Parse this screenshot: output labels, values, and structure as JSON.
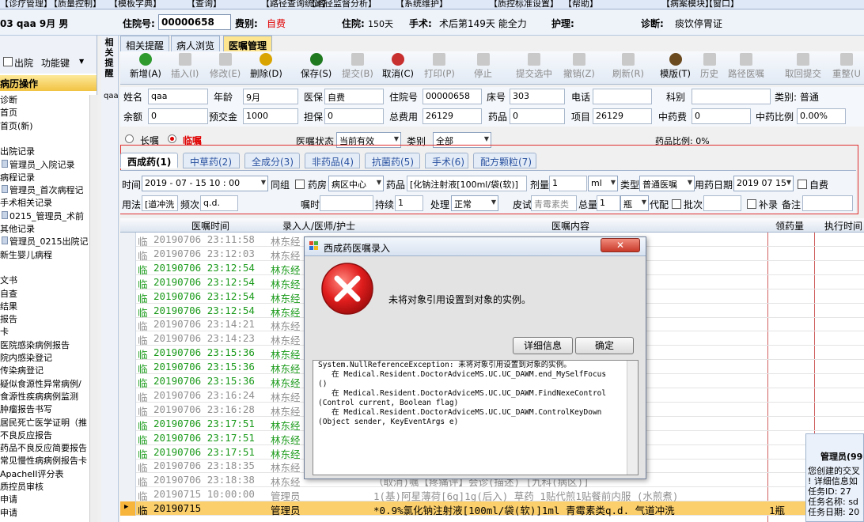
{
  "menu": [
    "【诊疗管理】",
    "【质量控制】",
    "【模板字典】",
    "【查询】",
    "【路径查询统计】",
    "【路径监督分析】",
    "【系统维护】",
    "【质控标准设置】",
    "【帮助】",
    "【病案模块】",
    "【窗口】"
  ],
  "patient": {
    "left": "03  qaa 9月 男",
    "inpatient_label": "住院号:",
    "inpatient_no": "00000658",
    "fee_label": "费别:",
    "fee": "自费",
    "stay_label": "住院:",
    "stay": "150天",
    "surgery_label": "手术:",
    "surgery": "术后第149天 能全力",
    "nursing_label": "护理:",
    "diag_label": "诊断:",
    "diag": "痰饮停胃证"
  },
  "left_panel": {
    "discharge": "出院",
    "func_key": "功能键",
    "section": "病历操作",
    "items": [
      "诊断",
      "首页",
      "首页(新)",
      "",
      "出院记录",
      "管理员_入院记录",
      "病程记录",
      "管理员_首次病程记",
      "手术相关记录",
      "0215_管理员_术前",
      "其他记录",
      "管理员_0215出院记",
      "新生婴儿病程",
      "",
      "文书",
      "自查",
      "结果",
      "报告",
      "卡",
      "医院感染病例报告",
      "院内感染登记",
      "传染病登记",
      "疑似食源性异常病例/",
      "食源性疾病病例监测",
      "肿瘤报告书写",
      "居民死亡医学证明（推",
      "不良反应报告",
      "药品不良反应简要报告",
      "常见慢性病病例报告卡",
      "ApacheII评分表",
      "质控员审核",
      "申请",
      "申请"
    ]
  },
  "vtabs": [
    "相关提醒",
    "qaa"
  ],
  "tabs": [
    "相关提醒",
    "病人浏览",
    "医嘱管理"
  ],
  "toolbar": [
    {
      "label": "新增(A)",
      "icon": "add-icon",
      "enabled": true,
      "color": "#2e9a2e"
    },
    {
      "label": "插入(I)",
      "icon": "insert-icon",
      "enabled": false
    },
    {
      "label": "修改(E)",
      "icon": "edit-icon",
      "enabled": false
    },
    {
      "label": "删除(D)",
      "icon": "delete-icon",
      "enabled": true,
      "color": "#d9a400"
    },
    {
      "label": "保存(S)",
      "icon": "save-icon",
      "enabled": true,
      "color": "#1f7a1f"
    },
    {
      "label": "提交(B)",
      "icon": "submit-icon",
      "enabled": false
    },
    {
      "label": "取消(C)",
      "icon": "undo-icon",
      "enabled": true,
      "color": "#c83030"
    },
    {
      "label": "打印(P)",
      "icon": "print-icon",
      "enabled": false
    },
    {
      "label": "停止",
      "icon": "stop-icon",
      "enabled": false
    },
    {
      "label": "提交选中",
      "icon": "submit-selected-icon",
      "enabled": false
    },
    {
      "label": "撤销(Z)",
      "icon": "trash-icon",
      "enabled": false
    },
    {
      "label": "刷新(R)",
      "icon": "refresh-icon",
      "enabled": false
    },
    {
      "label": "模版(T)",
      "icon": "template-icon",
      "enabled": true,
      "color": "#6b4a1f"
    },
    {
      "label": "历史",
      "icon": "history-icon",
      "enabled": false
    },
    {
      "label": "路径医嘱",
      "icon": "path-order-icon",
      "enabled": false
    },
    {
      "label": "取回提交",
      "icon": "retrieve-icon",
      "enabled": false
    },
    {
      "label": "重整(U",
      "icon": "reorganize-icon",
      "enabled": false
    }
  ],
  "info": {
    "name_label": "姓名",
    "name": "qaa",
    "age_label": "年龄",
    "age": "9月",
    "insurance_label": "医保",
    "insurance": "自费",
    "inpatient_label": "住院号",
    "inpatient": "00000658",
    "bed_label": "床号",
    "bed": "303",
    "phone_label": "电话",
    "phone": "",
    "dept_label": "科别",
    "dept": "",
    "category": "类别: 普通",
    "balance_label": "余额",
    "balance": "0",
    "deposit_label": "预交金",
    "deposit": "1000",
    "guarantee_label": "担保",
    "guarantee": "0",
    "total_label": "总费用",
    "total": "26129",
    "drug_label": "药品",
    "drug": "0",
    "item_label": "项目",
    "item": "26129",
    "tcm_label": "中药费",
    "tcm": "0",
    "tcm_ratio_label": "中药比例",
    "tcm_ratio": "0.00%"
  },
  "order_row": {
    "long": "长嘱",
    "temp": "临嘱",
    "status_label": "医嘱状态",
    "status": "当前有效",
    "type_label": "类别",
    "type": "全部",
    "drug_ratio": "药品比例: 0%"
  },
  "order_tabs": [
    "西成药(1)",
    "中草药(2)",
    "全成分(3)",
    "非药品(4)",
    "抗菌药(5)",
    "手术(6)",
    "配方颗粒(7)"
  ],
  "entry": {
    "time_label": "时间",
    "time": "2019 - 07 - 15 10 : 00",
    "group_label": "同组",
    "pharmacy_label": "药房",
    "pharmacy": "病区中心",
    "drug_label": "药品",
    "drug": "[化钠注射液[100ml/袋(软)]",
    "dose_label": "剂量",
    "dose": "1",
    "unit": "ml",
    "kind_label": "类型",
    "kind": "普通医嘱",
    "date_label": "用药日期",
    "date": "2019 07 15",
    "selfpay_label": "自费",
    "usage_label": "用法",
    "usage": "[道冲洗",
    "freq_label": "频次",
    "freq": "q.d.",
    "instruct_label": "嘱时",
    "duration_label": "持续",
    "duration": "1",
    "handle_label": "处理",
    "handle": "正常",
    "skin_label": "皮试",
    "skin": "青霉素类",
    "total_label": "总量",
    "total": "1",
    "total_unit": "瓶",
    "dai_label": "代配",
    "batch_label": "批次",
    "supp_label": "补录",
    "remark_label": "备注"
  },
  "table": {
    "headers": [
      "医嘱时间",
      "录入人/医师/护士",
      "医嘱内容",
      "领药量",
      "执行时间"
    ],
    "rows": [
      {
        "type": "临",
        "time": "20190706 23:11:58",
        "person": "林东经",
        "content": "",
        "qty": "",
        "color": "#909090"
      },
      {
        "type": "临",
        "time": "20190706 23:12:03",
        "person": "林东经",
        "content": "",
        "qty": "",
        "color": "#909090"
      },
      {
        "type": "临",
        "time": "20190706 23:12:54",
        "person": "林东经",
        "content": "",
        "qty": "",
        "color": "#1a9a1a"
      },
      {
        "type": "临",
        "time": "20190706 23:12:54",
        "person": "林东经",
        "content": "",
        "qty": "",
        "color": "#1a9a1a"
      },
      {
        "type": "临",
        "time": "20190706 23:12:54",
        "person": "林东经",
        "content": "",
        "qty": "",
        "color": "#1a9a1a"
      },
      {
        "type": "临",
        "time": "20190706 23:12:54",
        "person": "林东经",
        "content": "",
        "qty": "",
        "color": "#1a9a1a"
      },
      {
        "type": "临",
        "time": "20190706 23:14:21",
        "person": "林东经",
        "content": "",
        "qty": "",
        "color": "#909090"
      },
      {
        "type": "临",
        "time": "20190706 23:14:23",
        "person": "林东经",
        "content": "",
        "qty": "",
        "color": "#909090"
      },
      {
        "type": "临",
        "time": "20190706 23:15:36",
        "person": "林东经",
        "content": "",
        "qty": "",
        "color": "#1a9a1a"
      },
      {
        "type": "临",
        "time": "20190706 23:15:36",
        "person": "林东经",
        "content": "",
        "qty": "",
        "color": "#1a9a1a"
      },
      {
        "type": "临",
        "time": "20190706 23:15:36",
        "person": "林东经",
        "content": "",
        "qty": "",
        "color": "#1a9a1a"
      },
      {
        "type": "临",
        "time": "20190706 23:16:24",
        "person": "林东经",
        "content": "",
        "qty": "",
        "color": "#909090"
      },
      {
        "type": "临",
        "time": "20190706 23:16:28",
        "person": "林东经",
        "content": "",
        "qty": "",
        "color": "#909090"
      },
      {
        "type": "临",
        "time": "20190706 23:17:51",
        "person": "林东经",
        "content": "",
        "qty": "",
        "color": "#1a9a1a"
      },
      {
        "type": "临",
        "time": "20190706 23:17:51",
        "person": "林东经",
        "content": "",
        "qty": "",
        "color": "#1a9a1a"
      },
      {
        "type": "临",
        "time": "20190706 23:17:51",
        "person": "林东经",
        "content": "",
        "qty": "",
        "color": "#1a9a1a"
      },
      {
        "type": "临",
        "time": "20190706 23:18:35",
        "person": "林东经",
        "content": "",
        "qty": "",
        "color": "#909090"
      },
      {
        "type": "临",
        "time": "20190706 23:18:38",
        "person": "林东经",
        "content": "（取消)嘱【疼痛评】会诊(描述)    [九科(病区)]",
        "qty": "",
        "color": "#909090"
      },
      {
        "type": "临",
        "time": "20190715 10:00:00",
        "person": "管理员",
        "content": "1(基)阿星薄荷[6g]1g(后入) 草药 1贴代煎1贴餐前内服 (水煎煮)",
        "qty": "",
        "color": "#909090"
      },
      {
        "type": "临",
        "time": "20190715",
        "person": "管理员",
        "content": "*0.9%氯化钠注射液[100ml/袋(软)]1ml 青霉素类q.d. 气道冲洗",
        "qty": "1瓶",
        "color": "#000000",
        "selected": true
      }
    ]
  },
  "right_info": {
    "title": "管理员(99",
    "line1": "您创建的交叉",
    "line2": "! 详细信息如",
    "line3": "任务ID: 27",
    "line4": "任务名称: sd",
    "line5": "任务日期: 20"
  },
  "dialog": {
    "title": "西成药医嘱录入",
    "message": "未将对象引用设置到对象的实例。",
    "detail_btn": "详细信息",
    "ok_btn": "确定",
    "detail": [
      "System.NullReferenceException: 未将对象引用设置到对象的实例。",
      "   在 Medical.Resident.DoctorAdviceMS.UC.UC_DAWM.end_MySelfFocus",
      "()",
      "   在 Medical.Resident.DoctorAdviceMS.UC.UC_DAWM.FindNexeControl",
      "(Control current, Boolean flag)",
      "   在 Medical.Resident.DoctorAdviceMS.UC.UC_DAWM.ControlKeyDown",
      "(Object sender, KeyEventArgs e)"
    ]
  }
}
